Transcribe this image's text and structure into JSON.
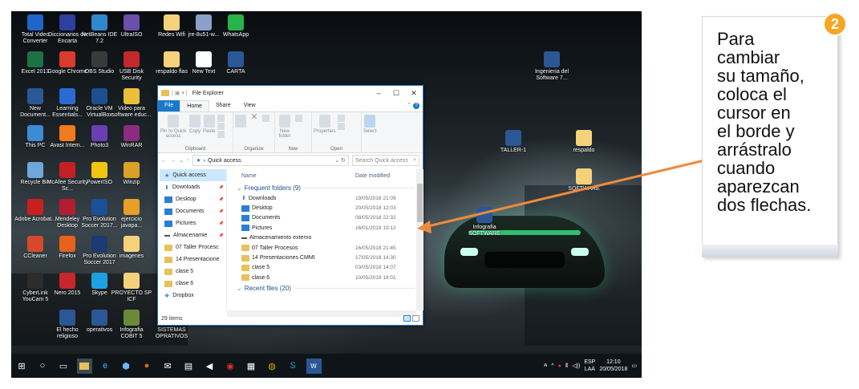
{
  "desktop_icons": [
    {
      "label": "Total Video Converter",
      "color": "#1e66c9"
    },
    {
      "label": "Diccionarios de Encarta",
      "color": "#2e3fa0"
    },
    {
      "label": "NetBeans IDE 7.2",
      "color": "#2f87cf"
    },
    {
      "label": "UltraISO",
      "color": "#6b4fa8"
    },
    {
      "label": "Redes Wifi",
      "color": "#f3d27a"
    },
    {
      "label": "jre-8u51-w...",
      "color": "#8aa0c8"
    },
    {
      "label": "WhatsApp",
      "color": "#27b44a"
    },
    {
      "label": "Excel 2013",
      "color": "#1d7245"
    },
    {
      "label": "Google Chrome",
      "color": "#d93b2f"
    },
    {
      "label": "OBS Studio",
      "color": "#3a3a3a"
    },
    {
      "label": "USB Disk Security",
      "color": "#c02a2a"
    },
    {
      "label": "respaldo flas",
      "color": "#f3d27a"
    },
    {
      "label": "New Text",
      "color": "#ffffff"
    },
    {
      "label": "CARTA",
      "color": "#2b5797"
    },
    {
      "label": "New Document...",
      "color": "#2b5797"
    },
    {
      "label": "Learning Essentials...",
      "color": "#2b6ad1"
    },
    {
      "label": "Oracle VM VirtualBox",
      "color": "#1c4f8c"
    },
    {
      "label": "Video para software educ...",
      "color": "#e8c03a"
    },
    {
      "label": "This PC",
      "color": "#3d8ad6"
    },
    {
      "label": "Avast Intern...",
      "color": "#ef7b1c"
    },
    {
      "label": "Photo3",
      "color": "#6a3fb5"
    },
    {
      "label": "WinRAR",
      "color": "#8b2c7e"
    },
    {
      "label": "Recycle Bin",
      "color": "#6fa7dc"
    },
    {
      "label": "McAfee Security Sc...",
      "color": "#c32026"
    },
    {
      "label": "PowerISO",
      "color": "#f1c40f"
    },
    {
      "label": "Winzip",
      "color": "#d9a227"
    },
    {
      "label": "Adobe Acrobat...",
      "color": "#c8201e"
    },
    {
      "label": "Mendeley Desktop",
      "color": "#b21e2f"
    },
    {
      "label": "Pro Evolution Soccer 2017...",
      "color": "#1a4f9a"
    },
    {
      "label": "ejercicio javapa...",
      "color": "#e6a02a"
    },
    {
      "label": "CCleaner",
      "color": "#d64a2b"
    },
    {
      "label": "Firefox",
      "color": "#e7611d"
    },
    {
      "label": "Pro Evolution Soccer 2017",
      "color": "#1c3a73"
    },
    {
      "label": "imagenes",
      "color": "#f3d27a"
    },
    {
      "label": "CyberLink YouCam 5",
      "color": "#2c2c2c"
    },
    {
      "label": "Nero 2015",
      "color": "#c9252c"
    },
    {
      "label": "Skype",
      "color": "#1fa0e3"
    },
    {
      "label": "PROYECTO SP ICF",
      "color": "#f3d27a"
    },
    {
      "label": "El hecho religioso",
      "color": "#2b5797"
    },
    {
      "label": "operativos",
      "color": "#2b5797"
    },
    {
      "label": "Infografia COBIT 5",
      "color": "#6a8a3a"
    },
    {
      "label": "SISTEMAS OPRATIVOS",
      "color": "#2b5797"
    },
    {
      "label": "Ingenieria del Software 7...",
      "color": "#2b5797"
    },
    {
      "label": "TALLER-1",
      "color": "#2b5797"
    },
    {
      "label": "respaldo",
      "color": "#f3d27a"
    },
    {
      "label": "SOFTWARE",
      "color": "#f3d27a"
    },
    {
      "label": "Infografia SOFTWARE",
      "color": "#2b5797"
    }
  ],
  "explorer": {
    "title": "File Explorer",
    "tabs": [
      "File",
      "Home",
      "Share",
      "View"
    ],
    "ribbon": {
      "clipboard": {
        "label": "Clipboard",
        "items": [
          "Pin to Quick access",
          "Copy",
          "Paste"
        ]
      },
      "organize": {
        "label": "Organize"
      },
      "new": {
        "label": "New",
        "items": [
          "New folder"
        ]
      },
      "open": {
        "label": "Open",
        "items": [
          "Properties"
        ]
      },
      "select": {
        "items": [
          "Select"
        ]
      }
    },
    "address": {
      "path": "Quick access",
      "search_placeholder": "Search Quick access"
    },
    "nav": [
      {
        "label": "Quick access",
        "pinned": false
      },
      {
        "label": "Downloads",
        "pinned": true
      },
      {
        "label": "Desktop",
        "pinned": true
      },
      {
        "label": "Documents",
        "pinned": true
      },
      {
        "label": "Pictures",
        "pinned": true
      },
      {
        "label": "Almacenamie",
        "pinned": true
      },
      {
        "label": "07 Taller Procesc",
        "pinned": false
      },
      {
        "label": "14 Presentacione",
        "pinned": false
      },
      {
        "label": "clase 5",
        "pinned": false
      },
      {
        "label": "clase 6",
        "pinned": false
      },
      {
        "label": "Dropbox",
        "pinned": false
      }
    ],
    "columns": {
      "name": "Name",
      "date": "Date modified"
    },
    "frequent_header": "Frequent folders (9)",
    "recent_header": "Recent files (20)",
    "rows": [
      {
        "name": "Downloads",
        "date": "19/05/2018 21:09",
        "icon": "download"
      },
      {
        "name": "Desktop",
        "date": "20/05/2018 12:03",
        "icon": "blue"
      },
      {
        "name": "Documents",
        "date": "08/05/2018 22:32",
        "icon": "doc"
      },
      {
        "name": "Pictures",
        "date": "16/01/2018 19:12",
        "icon": "pic"
      },
      {
        "name": "Almacenamiento externo",
        "date": "",
        "icon": "drive"
      },
      {
        "name": "07 Taller Procesos",
        "date": "16/05/2018 21:45",
        "icon": "folder"
      },
      {
        "name": "14 Presentaciones CMMI",
        "date": "17/05/2018 14:30",
        "icon": "folder"
      },
      {
        "name": "clase 5",
        "date": "03/05/2018 14:07",
        "icon": "folder"
      },
      {
        "name": "clase 6",
        "date": "10/05/2018 18:01",
        "icon": "folder"
      }
    ],
    "status": "29 items"
  },
  "taskbar": {
    "tray": {
      "lang_top": "ESP",
      "lang_bottom": "LAA",
      "time": "12:10",
      "date": "20/05/2018"
    }
  },
  "callout": {
    "number": "2",
    "lines": [
      "Para",
      "cambiar",
      "su tamaño,",
      "coloca el",
      "cursor en",
      "el borde y",
      "arrástralo",
      "cuando",
      "aparezcan",
      "dos flechas."
    ]
  }
}
